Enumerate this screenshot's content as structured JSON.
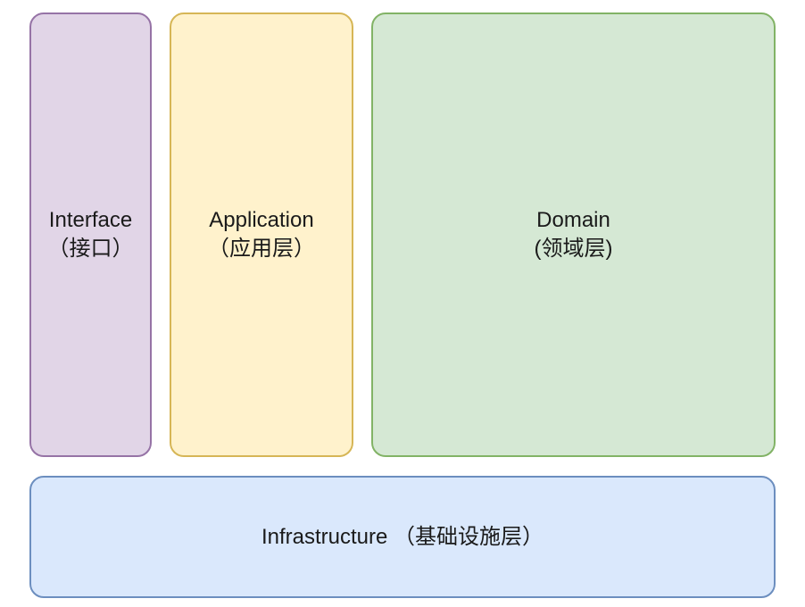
{
  "layers": {
    "interface": {
      "name": "Interface",
      "subtitle": "（接口）"
    },
    "application": {
      "name": "Application",
      "subtitle": "（应用层）"
    },
    "domain": {
      "name": "Domain",
      "subtitle": "(领域层)"
    },
    "infrastructure": {
      "name": "Infrastructure",
      "subtitle": " （基础设施层）"
    }
  },
  "colors": {
    "interface_fill": "#e1d5e7",
    "interface_stroke": "#9673a6",
    "application_fill": "#fff2cc",
    "application_stroke": "#d6b656",
    "domain_fill": "#d5e8d4",
    "domain_stroke": "#82b366",
    "infrastructure_fill": "#dae8fc",
    "infrastructure_stroke": "#6c8ebf"
  }
}
